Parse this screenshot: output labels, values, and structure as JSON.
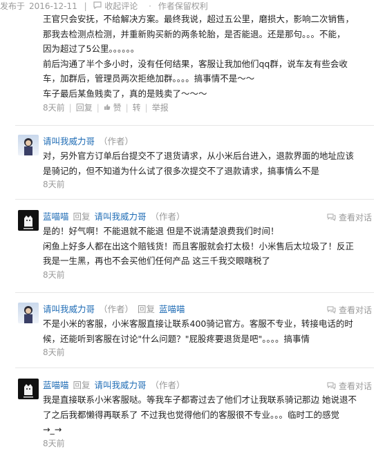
{
  "top": {
    "publish_label": "发布于",
    "date": "2016-12-11",
    "collapse_label": "收起评论",
    "rights_label": "作者保留权利"
  },
  "first_comment": {
    "lines": [
      "王官只会安抚，不给解决方案。最终我说，超过五公里，磨损大，影响二次销售，",
      "那我去检测点检测，并重新购买新的两条轮胎，是否能退。还是那句。。。不能，",
      "因为超过了5公里。。。。。。",
      "前后沟通了半个多小时，没有任何结果，客服让我加他们qq群，说车友有些会收",
      "车，加群后，管理员两次拒绝加群。。。。搞事情不是～～",
      "车子最后某鱼贱卖了，真的是贱卖了～～～"
    ],
    "time": "8天前",
    "reply": "回复",
    "like": "赞",
    "share": "转",
    "report": "举报"
  },
  "comments": [
    {
      "avatar": "boy-avatar",
      "author": "请叫我威力哥",
      "role": "（作者）",
      "reply_label": "",
      "reply_to": "",
      "reply_to_role": "",
      "view_conversation": "",
      "lines": [
        "对，另外官方订单后台提交不了退货请求，从小米后台进入，退款界面的地址应该",
        "是骑记的，但不知道为什么试了很多次提交不了退款请求，搞事情么不是"
      ],
      "time": "8天前"
    },
    {
      "avatar": "cat-avatar",
      "author": "蓝喵喵",
      "role": "",
      "reply_label": "回复",
      "reply_to": "请叫我威力哥",
      "reply_to_role": "（作者）",
      "view_conversation": "查看对话",
      "lines": [
        "是的！好气啊！不能退就不能退 但是不说清楚浪费我们时间！",
        "闲鱼上好多人都在出这个赔钱货！而且客服就会打太极！小米售后太垃圾了！反正",
        "我是一生黑，再也不会买他们任何产品 这三千我交眼瞎税了"
      ],
      "time": "8天前"
    },
    {
      "avatar": "boy-avatar",
      "author": "请叫我威力哥",
      "role": "（作者）",
      "reply_label": "回复",
      "reply_to": "蓝喵喵",
      "reply_to_role": "",
      "view_conversation": "查看对话",
      "lines": [
        "不是小米的客服，小米客服直接让联系400骑记官方。客服不专业，转接电话的时",
        "候，还能听到客服在讨论\"什么问题？\"屁股疼要退货是吧\"。。。。搞事情"
      ],
      "time": "8天前"
    },
    {
      "avatar": "cat-avatar",
      "author": "蓝喵喵",
      "role": "",
      "reply_label": "回复",
      "reply_to": "请叫我威力哥",
      "reply_to_role": "（作者）",
      "view_conversation": "查看对话",
      "lines": [
        "我是直接联系小米客服哒。等我车子都寄过去了他们才让我联系骑记那边 她说退不",
        "了之后我都懒得再联系了 不过我也觉得他们的客服很不专业。。。临时工的感觉",
        "→_→"
      ],
      "time": "8天前"
    }
  ]
}
